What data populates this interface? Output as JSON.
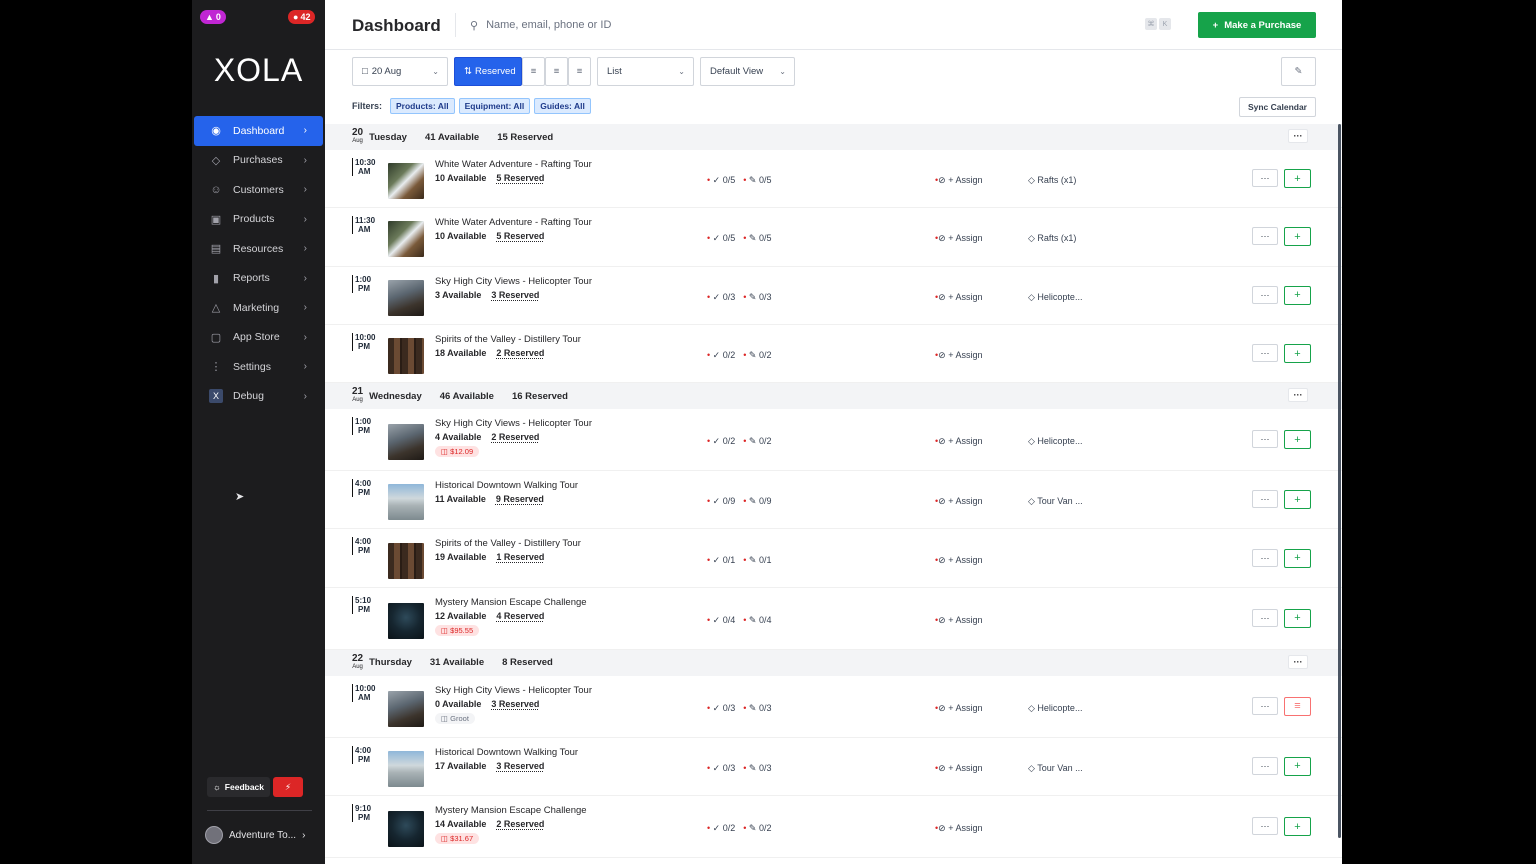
{
  "sidebar": {
    "badge_left": "0",
    "badge_right": "42",
    "logo": "XOLA",
    "items": [
      {
        "label": "Dashboard",
        "icon": "dashboard-icon"
      },
      {
        "label": "Purchases",
        "icon": "tag-icon"
      },
      {
        "label": "Customers",
        "icon": "users-icon"
      },
      {
        "label": "Products",
        "icon": "box-icon"
      },
      {
        "label": "Resources",
        "icon": "clipboard-icon"
      },
      {
        "label": "Reports",
        "icon": "bar-chart-icon"
      },
      {
        "label": "Marketing",
        "icon": "megaphone-icon"
      },
      {
        "label": "App Store",
        "icon": "app-store-icon"
      },
      {
        "label": "Settings",
        "icon": "sliders-icon"
      },
      {
        "label": "Debug",
        "icon": "x-icon"
      }
    ],
    "feedback_label": "Feedback",
    "account_label": "Adventure To..."
  },
  "header": {
    "title": "Dashboard",
    "search_placeholder": "Name, email, phone or ID",
    "purchase_label": "Make a Purchase"
  },
  "toolbar": {
    "date": "20 Aug",
    "reserved_label": "Reserved",
    "view_mode": "List",
    "saved_view": "Default View"
  },
  "filters": {
    "label": "Filters:",
    "chips": [
      "Products: All",
      "Equipment: All",
      "Guides: All"
    ],
    "sync_label": "Sync Calendar"
  },
  "days": [
    {
      "num": "20",
      "mon": "Aug",
      "name": "Tuesday",
      "available": "41 Available",
      "reserved": "15 Reserved",
      "rows": [
        {
          "time": "10:30",
          "ampm": "AM",
          "name": "White Water Adventure - Rafting Tour",
          "available": "10 Available",
          "reserved": "5 Reserved",
          "tag": "",
          "c1": "0/5",
          "c2": "0/5",
          "assign": "+ Assign",
          "equip": "Rafts (x1)",
          "thumb": "rafting"
        },
        {
          "time": "11:30",
          "ampm": "AM",
          "name": "White Water Adventure - Rafting Tour",
          "available": "10 Available",
          "reserved": "5 Reserved",
          "tag": "",
          "c1": "0/5",
          "c2": "0/5",
          "assign": "+ Assign",
          "equip": "Rafts (x1)",
          "thumb": "rafting"
        },
        {
          "time": "1:00",
          "ampm": "PM",
          "name": "Sky High City Views - Helicopter Tour",
          "available": "3 Available",
          "reserved": "3 Reserved",
          "tag": "",
          "c1": "0/3",
          "c2": "0/3",
          "assign": "+ Assign",
          "equip": "Helicopte...",
          "thumb": "heli"
        },
        {
          "time": "10:00",
          "ampm": "PM",
          "name": "Spirits of the Valley - Distillery Tour",
          "available": "18 Available",
          "reserved": "2 Reserved",
          "tag": "",
          "c1": "0/2",
          "c2": "0/2",
          "assign": "+ Assign",
          "equip": "",
          "thumb": "barrel"
        }
      ]
    },
    {
      "num": "21",
      "mon": "Aug",
      "name": "Wednesday",
      "available": "46 Available",
      "reserved": "16 Reserved",
      "rows": [
        {
          "time": "1:00",
          "ampm": "PM",
          "name": "Sky High City Views - Helicopter Tour",
          "available": "4 Available",
          "reserved": "2 Reserved",
          "tag": "$12.09",
          "c1": "0/2",
          "c2": "0/2",
          "assign": "+ Assign",
          "equip": "Helicopte...",
          "thumb": "heli"
        },
        {
          "time": "4:00",
          "ampm": "PM",
          "name": "Historical Downtown Walking Tour",
          "available": "11 Available",
          "reserved": "9 Reserved",
          "tag": "",
          "c1": "0/9",
          "c2": "0/9",
          "assign": "+ Assign",
          "equip": "Tour Van ...",
          "thumb": "building"
        },
        {
          "time": "4:00",
          "ampm": "PM",
          "name": "Spirits of the Valley - Distillery Tour",
          "available": "19 Available",
          "reserved": "1 Reserved",
          "tag": "",
          "c1": "0/1",
          "c2": "0/1",
          "assign": "+ Assign",
          "equip": "",
          "thumb": "barrel"
        },
        {
          "time": "5:10",
          "ampm": "PM",
          "name": "Mystery Mansion Escape Challenge",
          "available": "12 Available",
          "reserved": "4 Reserved",
          "tag": "$95.55",
          "c1": "0/4",
          "c2": "0/4",
          "assign": "+ Assign",
          "equip": "",
          "thumb": "mystery"
        }
      ]
    },
    {
      "num": "22",
      "mon": "Aug",
      "name": "Thursday",
      "available": "31 Available",
      "reserved": "8 Reserved",
      "rows": [
        {
          "time": "10:00",
          "ampm": "AM",
          "name": "Sky High City Views - Helicopter Tour",
          "available": "0 Available",
          "reserved": "3 Reserved",
          "tag": "Groot",
          "c1": "0/3",
          "c2": "0/3",
          "assign": "+ Assign",
          "equip": "Helicopte...",
          "thumb": "heli",
          "red": true
        },
        {
          "time": "4:00",
          "ampm": "PM",
          "name": "Historical Downtown Walking Tour",
          "available": "17 Available",
          "reserved": "3 Reserved",
          "tag": "",
          "c1": "0/3",
          "c2": "0/3",
          "assign": "+ Assign",
          "equip": "Tour Van ...",
          "thumb": "building"
        },
        {
          "time": "9:10",
          "ampm": "PM",
          "name": "Mystery Mansion Escape Challenge",
          "available": "14 Available",
          "reserved": "2 Reserved",
          "tag": "$31.67",
          "c1": "0/2",
          "c2": "0/2",
          "assign": "+ Assign",
          "equip": "",
          "thumb": "mystery"
        }
      ]
    }
  ],
  "colors": {
    "accent": "#2563eb",
    "success": "#16a34a",
    "danger": "#dc2626",
    "sidebar": "#1c1c1e"
  }
}
